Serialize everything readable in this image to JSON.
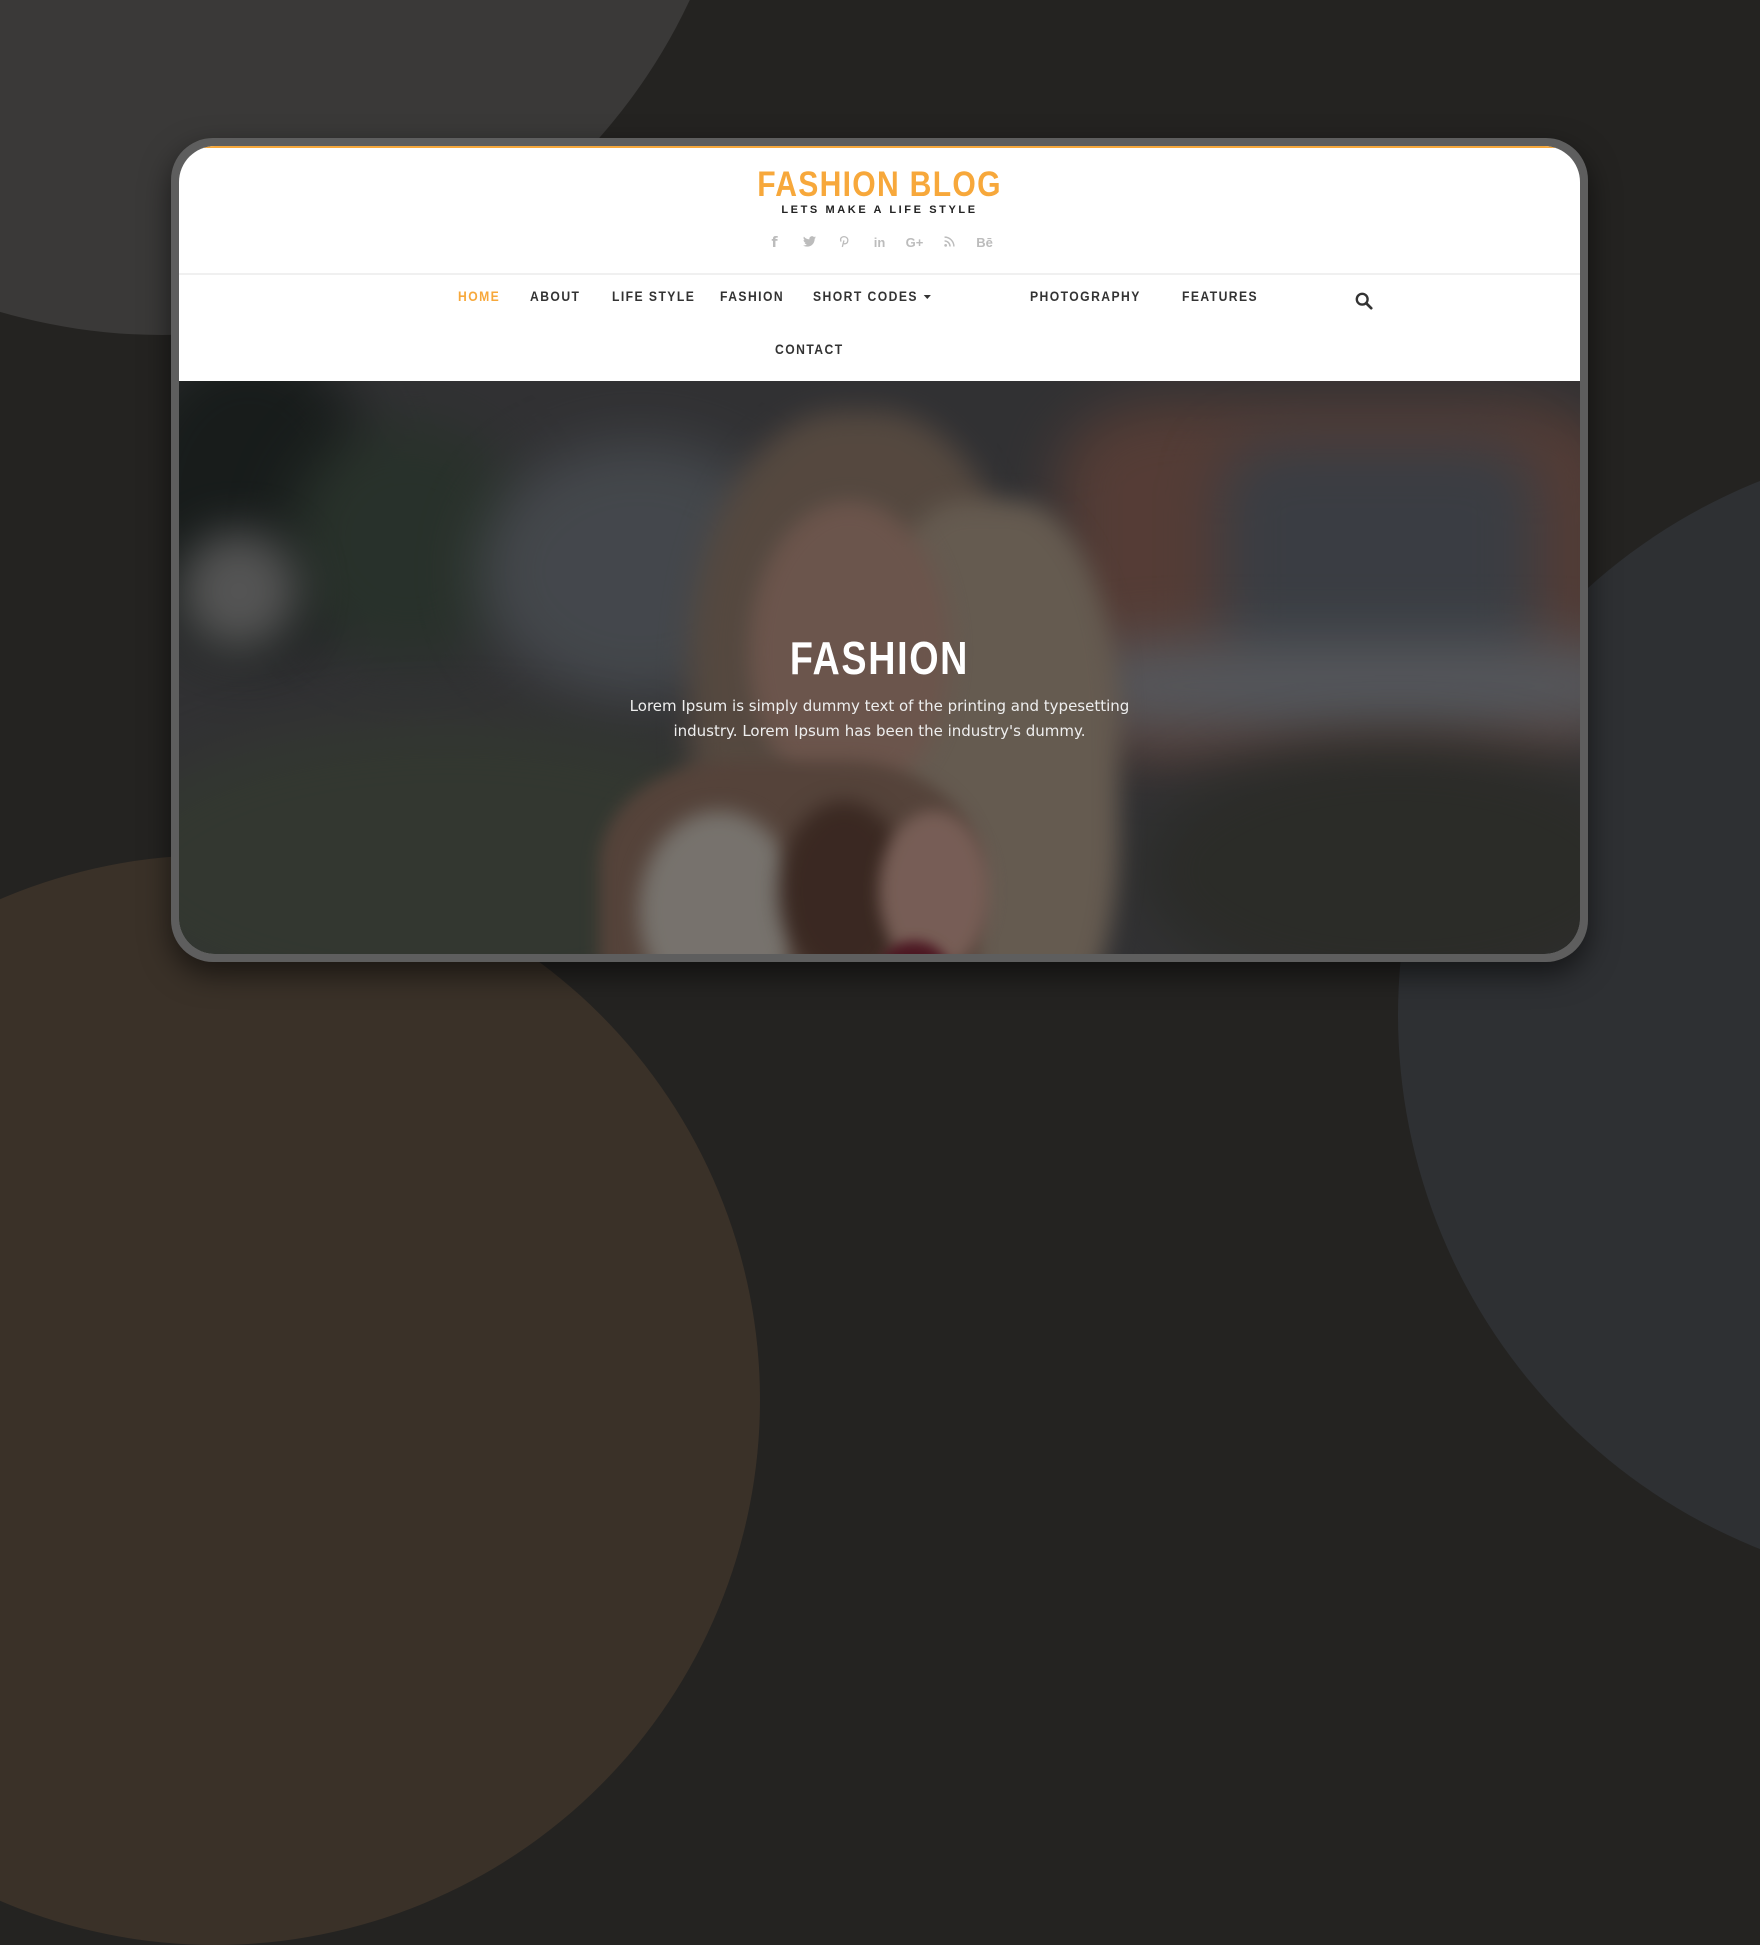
{
  "site": {
    "logo": "FASHION BLOG",
    "tagline": "LETS MAKE A LIFE STYLE",
    "accent_color": "#f7a83b"
  },
  "social": [
    {
      "name": "facebook-icon",
      "glyph": "f"
    },
    {
      "name": "twitter-icon",
      "glyph": "🐦"
    },
    {
      "name": "pinterest-icon",
      "glyph": "℗"
    },
    {
      "name": "linkedin-icon",
      "glyph": "in"
    },
    {
      "name": "google-plus-icon",
      "glyph": "G+"
    },
    {
      "name": "rss-icon",
      "glyph": "⌔"
    },
    {
      "name": "behance-icon",
      "glyph": "Bē"
    }
  ],
  "nav": {
    "items": [
      {
        "label": "HOME",
        "active": true
      },
      {
        "label": "ABOUT"
      },
      {
        "label": "LIFE STYLE"
      },
      {
        "label": "FASHION"
      },
      {
        "label": "SHORT CODES",
        "dropdown": true
      },
      {
        "label": "PHOTOGRAPHY"
      },
      {
        "label": "FEATURES"
      },
      {
        "label": "CONTACT"
      }
    ],
    "search_icon": "search-icon"
  },
  "hero": {
    "title": "FASHION",
    "text_line1": "Lorem Ipsum is simply dummy text of the printing and typesetting",
    "text_line2": "industry. Lorem Ipsum has been the industry's dummy."
  }
}
